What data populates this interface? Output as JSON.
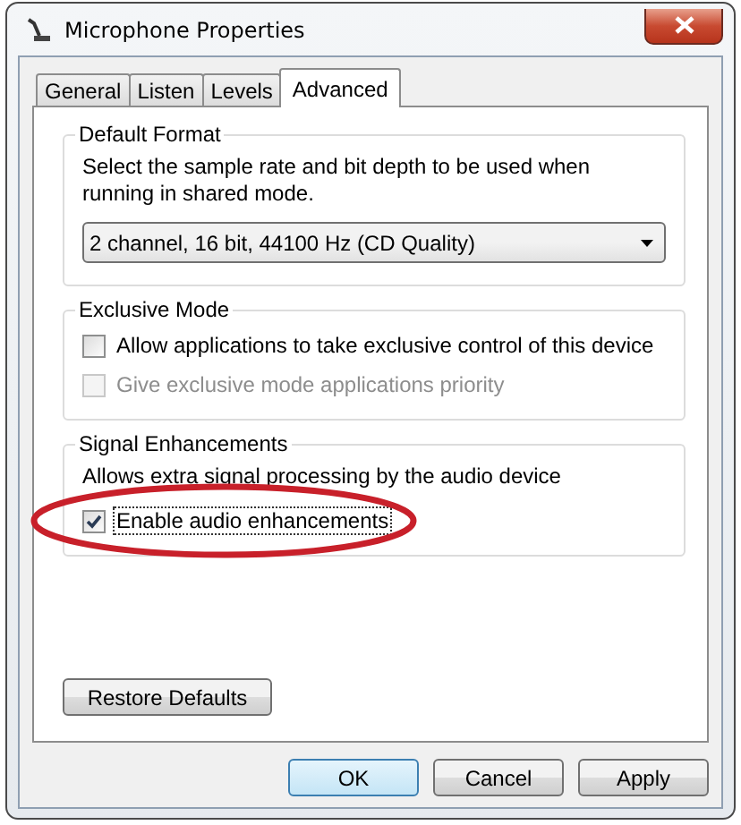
{
  "window": {
    "title": "Microphone Properties"
  },
  "tabs": [
    {
      "label": "General",
      "selected": false
    },
    {
      "label": "Listen",
      "selected": false
    },
    {
      "label": "Levels",
      "selected": false
    },
    {
      "label": "Advanced",
      "selected": true
    }
  ],
  "groups": [
    {
      "kind": "format",
      "title": "Default Format",
      "description": "Select the sample rate and bit depth to be used when running in shared mode.",
      "dropdown": {
        "value": "2 channel, 16 bit, 44100 Hz (CD Quality)"
      }
    },
    {
      "kind": "checks",
      "title": "Exclusive Mode",
      "checkboxes": [
        {
          "label": "Allow applications to take exclusive control of this device",
          "checked": false,
          "disabled": false,
          "focused": false,
          "circled": false
        },
        {
          "label": "Give exclusive mode applications priority",
          "checked": false,
          "disabled": true,
          "focused": false,
          "circled": false
        }
      ]
    },
    {
      "kind": "checks",
      "title": "Signal Enhancements",
      "description": "Allows extra signal processing by the audio device",
      "checkboxes": [
        {
          "label": "Enable audio enhancements",
          "checked": true,
          "disabled": false,
          "focused": true,
          "circled": true
        }
      ]
    }
  ],
  "restore_button": "Restore Defaults",
  "buttons": [
    {
      "label": "OK",
      "default": true
    },
    {
      "label": "Cancel",
      "default": false
    },
    {
      "label": "Apply",
      "default": false
    }
  ]
}
